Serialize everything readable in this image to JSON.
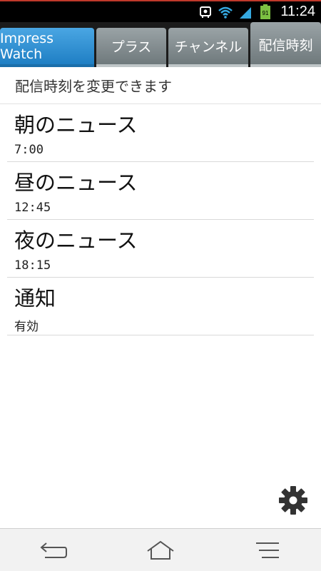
{
  "status_bar": {
    "time": "11:24",
    "battery": "91",
    "icons": [
      "notification-icon",
      "wifi-icon",
      "signal-icon",
      "battery-icon"
    ]
  },
  "tabs": [
    {
      "label": "Impress Watch",
      "active": true
    },
    {
      "label": "プラス",
      "active": false
    },
    {
      "label": "チャンネル",
      "active": false
    },
    {
      "label": "配信時刻",
      "active": false
    }
  ],
  "main": {
    "header": "配信時刻を変更できます",
    "items": [
      {
        "title": "朝のニュース",
        "value": "7:00"
      },
      {
        "title": "昼のニュース",
        "value": "12:45"
      },
      {
        "title": "夜のニュース",
        "value": "18:15"
      },
      {
        "title": "通知",
        "value": "有効"
      }
    ],
    "settings_icon": "gear-icon"
  },
  "nav": {
    "icons": [
      "back-icon",
      "home-icon",
      "menu-icon"
    ]
  },
  "colors": {
    "active_tab": "#2b8ad0",
    "inactive_tab": "#7f898c",
    "status_bar": "#000000"
  }
}
